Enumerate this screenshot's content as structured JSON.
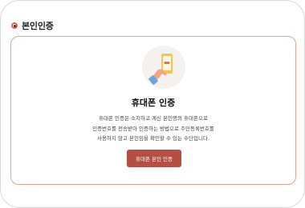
{
  "section": {
    "title": "본인인증"
  },
  "card": {
    "illustration_icon": "hand-holding-phone-icon",
    "title": "휴대폰 인증",
    "description": [
      "휴대폰 인증은 소지하고 계신 본인명의 휴대폰으로",
      "인증번호를 전송받아 인증하는 방법으로 주민등록번호를",
      "사용하지 않고 본인임을 확인할 수 있는 수단입니다."
    ],
    "button_label": "휴대폰 본인 인증"
  },
  "colors": {
    "accent": "#b64f43",
    "card_border": "#eaa092",
    "bullet": "#e8604a"
  }
}
